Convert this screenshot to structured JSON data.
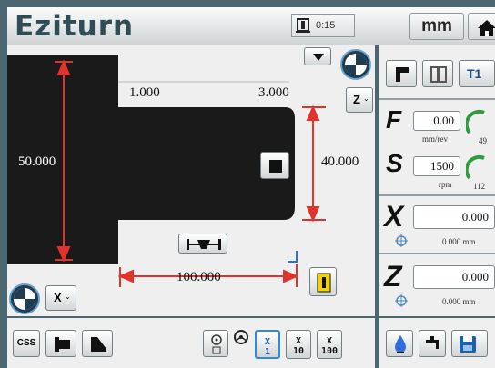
{
  "header": {
    "logo": "Eziturn",
    "timer": "0:15",
    "unit": "mm"
  },
  "drawing": {
    "dim_top_left": "1.000",
    "dim_top_right": "3.000",
    "dim_diameter_left": "50.000",
    "dim_diameter_right": "40.000",
    "dim_length": "100.000",
    "z_toggle_label": "Z",
    "x_toggle_label": "X"
  },
  "right_panel": {
    "tool_label": "T1",
    "feed": {
      "label": "F",
      "value": "0.00",
      "unit": "mm/rev",
      "gauge": "49"
    },
    "speed": {
      "label": "S",
      "value": "1500",
      "unit": "rpm",
      "gauge": "112"
    },
    "x_axis": {
      "label": "X",
      "value": "0.000",
      "sub_value": "0.000",
      "sub_unit": "mm"
    },
    "z_axis": {
      "label": "Z",
      "value": "0.000",
      "sub_value": "0.000",
      "sub_unit": "mm"
    }
  },
  "toolbar": {
    "css_label": "CSS",
    "jog": [
      {
        "axis": "X",
        "step": "1"
      },
      {
        "axis": "X",
        "step": "10"
      },
      {
        "axis": "X",
        "step": "100"
      }
    ]
  },
  "colors": {
    "frame": "#4a6670",
    "part": "#1a1a1a",
    "dimension": "#e0332c",
    "selected": "#2f89d8"
  }
}
